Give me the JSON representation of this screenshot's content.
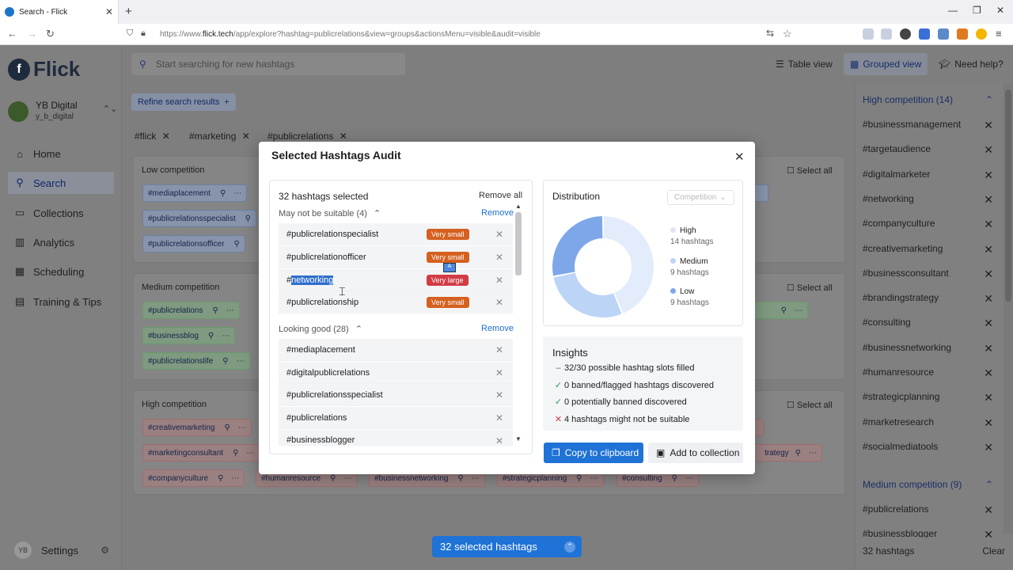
{
  "browser": {
    "tab_title": "Search - Flick",
    "url_prefix": "https://www.",
    "url_domain": "flick.tech",
    "url_path": "/app/explore?hashtag=publicrelations&view=groups&actionsMenu=visible&audit=visible"
  },
  "sidebar": {
    "brand": "Flick",
    "account_name": "YB Digital",
    "account_handle": "y_b_digital",
    "items": [
      {
        "label": "Home",
        "icon": "home-icon"
      },
      {
        "label": "Search",
        "icon": "search-icon"
      },
      {
        "label": "Collections",
        "icon": "folder-icon"
      },
      {
        "label": "Analytics",
        "icon": "chart-icon"
      },
      {
        "label": "Scheduling",
        "icon": "calendar-icon"
      },
      {
        "label": "Training & Tips",
        "icon": "book-icon"
      }
    ],
    "avatar_initials": "YB",
    "settings_label": "Settings"
  },
  "search": {
    "placeholder": "Start searching for new hashtags"
  },
  "toolbar": {
    "table_view": "Table view",
    "grouped_view": "Grouped view",
    "help": "Need help?"
  },
  "refine_label": "Refine search results",
  "filter_tags": [
    "#flick",
    "#marketing",
    "#publicrelations"
  ],
  "groups": {
    "low": {
      "title": "Low competition",
      "select_all": "Select all",
      "chips": [
        "#mediaplacement",
        "#publicrelationsspecialist",
        "#publicrelationsofficer"
      ]
    },
    "medium": {
      "title": "Medium competition",
      "select_all": "Select all",
      "chips": [
        "#publicrelations",
        "#businessblog",
        "#publicrelationslife"
      ]
    },
    "high": {
      "title": "High competition",
      "select_all": "Select all",
      "chips": [
        "#creativemarketing",
        "#marketingconsultant",
        "#companyculture",
        "#humanresource",
        "#businessnetworking",
        "#strategicplanning",
        "#consulting"
      ]
    }
  },
  "rightpanel": {
    "high_title": "High competition (14)",
    "high_items": [
      "#businessmanagement",
      "#targetaudience",
      "#digitalmarketer",
      "#networking",
      "#companyculture",
      "#creativemarketing",
      "#businessconsultant",
      "#brandingstrategy",
      "#consulting",
      "#businessnetworking",
      "#humanresource",
      "#strategicplanning",
      "#marketresearch",
      "#socialmediatools"
    ],
    "medium_title": "Medium competition (9)",
    "medium_items": [
      "#publicrelations",
      "#businessblogger"
    ],
    "footer_count": "32 hashtags",
    "clear": "Clear"
  },
  "selected_pill": "32 selected hashtags",
  "modal": {
    "title": "Selected Hashtags Audit",
    "selected_count": "32 hashtags selected",
    "remove_all": "Remove all",
    "section1_title": "May not be suitable (4)",
    "section1_remove": "Remove",
    "section1_rows": [
      {
        "prefix": "#",
        "tag": "publicrelationspecialist",
        "badge": "Very small",
        "color": "#d5601f"
      },
      {
        "prefix": "#",
        "tag": "publicrelationofficer",
        "badge": "Very small",
        "color": "#d5601f"
      },
      {
        "prefix": "#",
        "tag": "networking",
        "badge": "Very large",
        "color": "#d23c45"
      },
      {
        "prefix": "#",
        "tag": "publicrelationship",
        "badge": "Very small",
        "color": "#d5601f"
      }
    ],
    "section2_title": "Looking good (28)",
    "section2_remove": "Remove",
    "section2_rows": [
      "#mediaplacement",
      "#digitalpublicrelations",
      "#publicrelationsspecialist",
      "#publicrelations",
      "#businessblogger"
    ],
    "distribution_title": "Distribution",
    "distribution_select": "Competition",
    "distribution": [
      {
        "label": "High",
        "count": "14 hashtags",
        "value": 14,
        "color": "#e3ecfa"
      },
      {
        "label": "Medium",
        "count": "9 hashtags",
        "value": 9,
        "color": "#bcd4f6"
      },
      {
        "label": "Low",
        "count": "9 hashtags",
        "value": 9,
        "color": "#7ea7ea"
      }
    ],
    "insights_title": "Insights",
    "insights": [
      {
        "mark": "–",
        "text": "32/30 possible hashtag slots filled",
        "color": "#666666"
      },
      {
        "mark": "✓",
        "text": "0 banned/flagged hashtags discovered",
        "color": "#2a9a5a"
      },
      {
        "mark": "✓",
        "text": "0 potentially banned discovered",
        "color": "#2a9a5a"
      },
      {
        "mark": "✕",
        "text": "4 hashtags might not be suitable",
        "color": "#d23c45"
      }
    ],
    "copy_button": "Copy to clipboard",
    "add_button": "Add to collection"
  }
}
